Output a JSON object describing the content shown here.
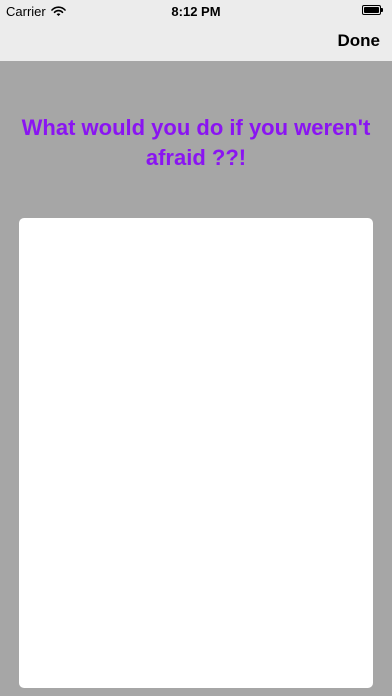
{
  "status_bar": {
    "carrier": "Carrier",
    "time": "8:12 PM",
    "wifi_icon": "wifi-icon",
    "battery_icon": "battery-icon",
    "battery_level": 1.0
  },
  "nav": {
    "done_label": "Done"
  },
  "prompt": {
    "title": "What would you do if you weren't afraid ??!",
    "color": "#8a14f2"
  },
  "editor": {
    "value": "",
    "background": "#ffffff"
  },
  "colors": {
    "page_background": "#a6a6a6",
    "bar_background": "#ececec"
  }
}
